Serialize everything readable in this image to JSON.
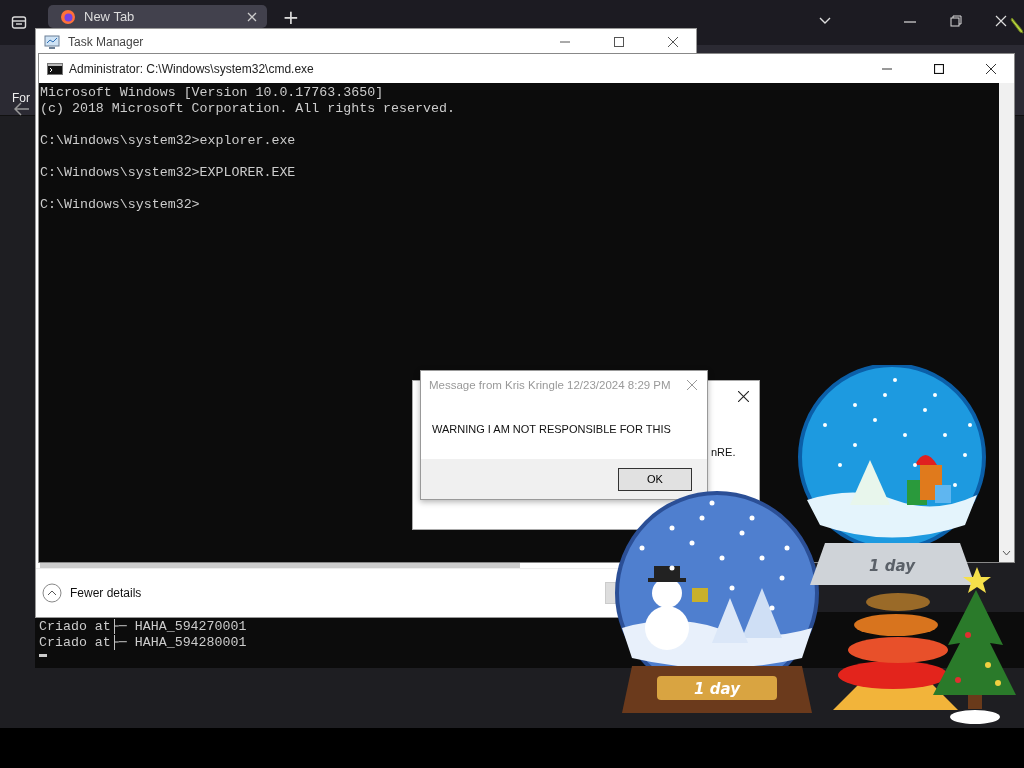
{
  "browser": {
    "tab": {
      "title": "New Tab",
      "selected": true
    },
    "new_tab_button": "+",
    "sidebar_text": "For"
  },
  "task_manager": {
    "title": "Task Manager",
    "footer_link": "Fewer details"
  },
  "cmd_window": {
    "title": "Administrator: C:\\Windows\\system32\\cmd.exe",
    "blocks": [
      [
        "Microsoft Windows [Version 10.0.17763.3650]",
        "(c) 2018 Microsoft Corporation. All rights reserved."
      ],
      [
        "C:\\Windows\\system32>explorer.exe"
      ],
      [
        "C:\\Windows\\system32>EXPLORER.EXE"
      ],
      [
        "C:\\Windows\\system32>"
      ]
    ]
  },
  "background_console": {
    "lines": [
      "Criado at├─ HAHA_594270001",
      "Criado at├─ HAHA_594280001"
    ]
  },
  "hidden_dialog": {
    "text": "nRE."
  },
  "message_box": {
    "title": "Message from Kris Kringle 12/23/2024 8:29 PM",
    "message": "WARNING I AM NOT RESPONSIBLE FOR THIS",
    "button": "OK"
  },
  "gadgets": [
    {
      "kind": "snowman-globe",
      "label": "1 day"
    },
    {
      "kind": "gifts-globe",
      "label": "1 day"
    },
    {
      "kind": "spiral-tree"
    },
    {
      "kind": "christmas-tree"
    }
  ]
}
